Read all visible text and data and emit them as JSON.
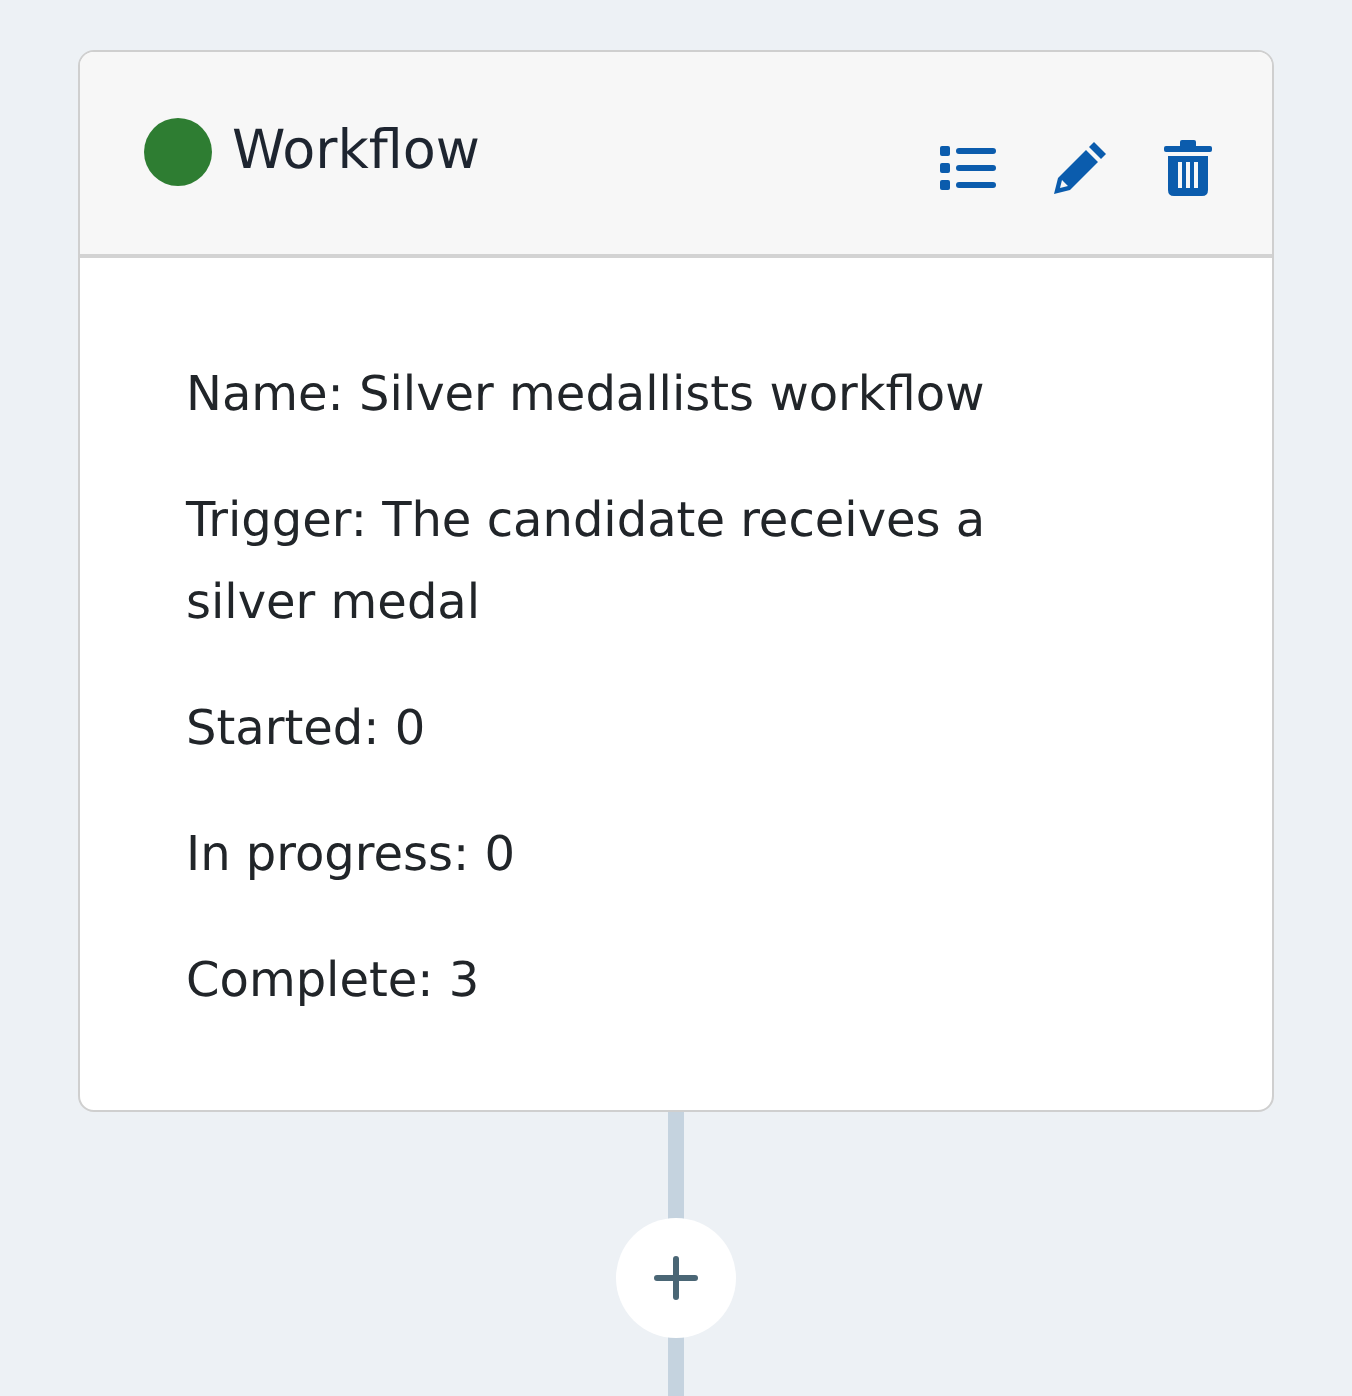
{
  "card": {
    "title": "Workflow",
    "color": "#2e7d32",
    "details": [
      {
        "text": "Name: Silver medallists workflow"
      },
      {
        "text": "Trigger: The candidate receives a silver medal"
      },
      {
        "text": "Started: 0"
      },
      {
        "text": "In progress: 0"
      },
      {
        "text": "Complete: 3"
      }
    ]
  }
}
